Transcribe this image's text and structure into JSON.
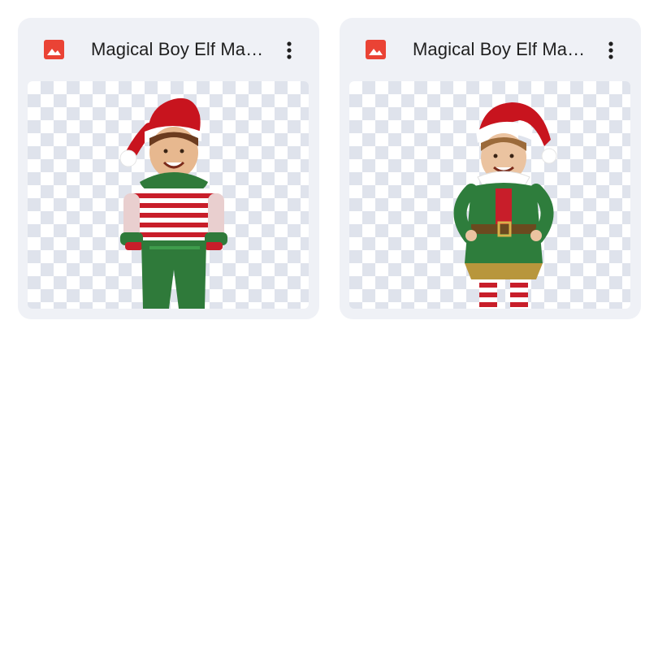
{
  "files": [
    {
      "title": "Magical Boy Elf Magical Boy Elf Mockup",
      "icon": "image-file-icon",
      "menu_icon": "more-vert-icon",
      "image": "elf-boy-striped-outfit"
    },
    {
      "title": "Magical Boy Elf Magical Boy Elf Mockup",
      "icon": "image-file-icon",
      "menu_icon": "more-vert-icon",
      "image": "elf-boy-green-tunic"
    }
  ],
  "colors": {
    "card_background": "#eff1f6",
    "image_icon_red": "#ea4335",
    "title_text": "#1f1f1f",
    "checker_light": "#ffffff",
    "checker_dark": "#dfe3ec"
  }
}
